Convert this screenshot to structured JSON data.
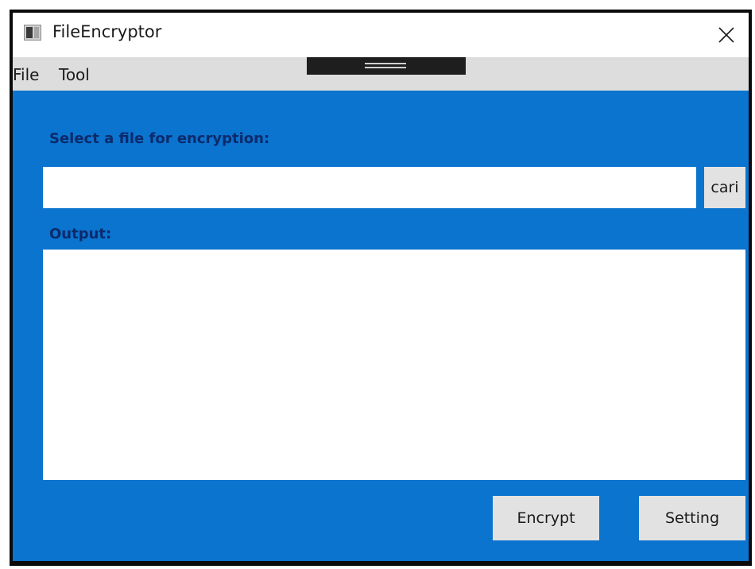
{
  "window": {
    "title": "FileEncryptor",
    "icon": "app-window-icon",
    "close_icon": "close-icon"
  },
  "menu": {
    "items": [
      {
        "label": "File"
      },
      {
        "label": "Tool"
      }
    ]
  },
  "main": {
    "select_label": "Select a file for encryption:",
    "file_path_value": "",
    "browse_label": "cari",
    "output_label": "Output:",
    "output_value": ""
  },
  "actions": {
    "encrypt_label": "Encrypt",
    "setting_label": "Setting"
  },
  "colors": {
    "accent_background": "#0a74cf",
    "label_text": "#0c2a6b",
    "menubar": "#dddddd",
    "button": "#e2e2e2"
  }
}
